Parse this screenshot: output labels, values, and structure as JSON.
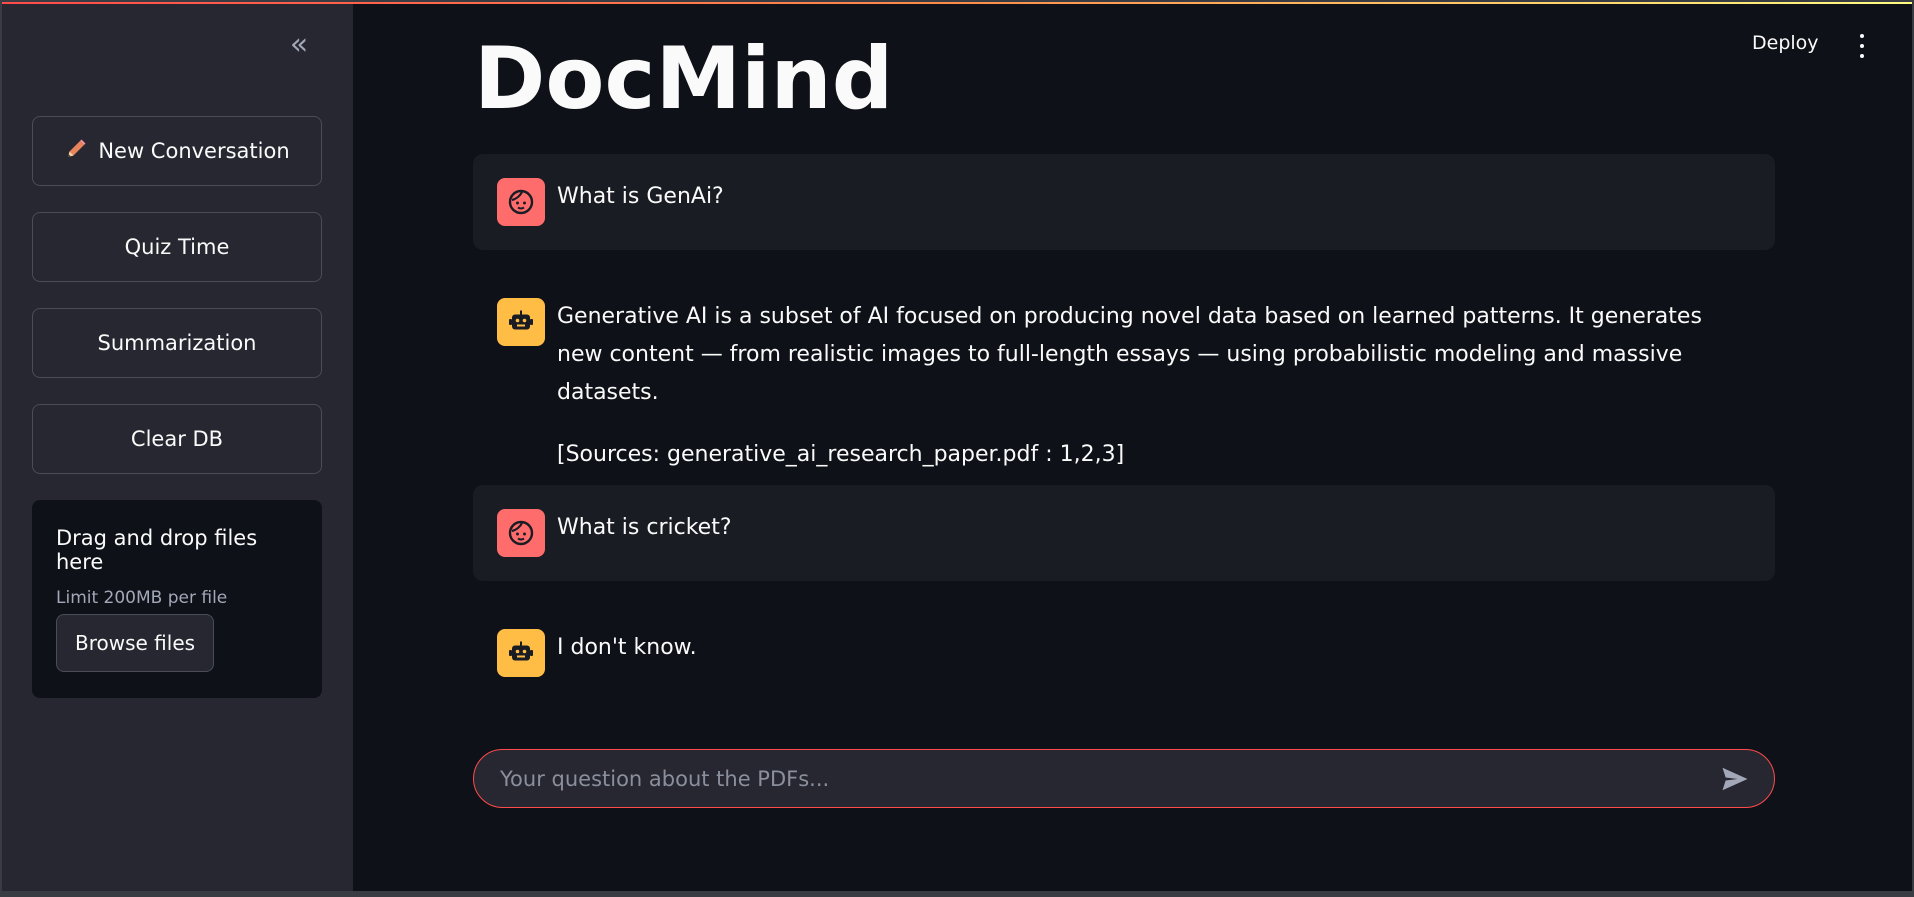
{
  "app": {
    "title": "DocMind",
    "deploy_label": "Deploy"
  },
  "sidebar": {
    "collapse_glyph": "«",
    "buttons": [
      {
        "icon": "pencil-icon",
        "emoji": "✏️",
        "label": "New Conversation"
      },
      {
        "label": "Quiz Time"
      },
      {
        "label": "Summarization"
      },
      {
        "label": "Clear DB"
      }
    ],
    "uploader": {
      "title": "Drag and drop files here",
      "limit": "Limit 200MB per file",
      "browse_label": "Browse files"
    }
  },
  "chat": {
    "messages": [
      {
        "role": "user",
        "avatar_icon": "user-face-icon",
        "paragraphs": [
          "What is GenAi?"
        ]
      },
      {
        "role": "assistant",
        "avatar_icon": "robot-icon",
        "paragraphs": [
          "Generative AI is a subset of AI focused on producing novel data based on learned patterns. It generates new content — from realistic images to full-length essays — using probabilistic modeling and massive datasets.",
          "[Sources: generative_ai_research_paper.pdf : 1,2,3]"
        ]
      },
      {
        "role": "user",
        "avatar_icon": "user-face-icon",
        "paragraphs": [
          "What is cricket?"
        ]
      },
      {
        "role": "assistant",
        "avatar_icon": "robot-icon",
        "paragraphs": [
          "I don't know."
        ]
      }
    ],
    "input": {
      "placeholder": "Your question about the PDFs...",
      "value": ""
    }
  },
  "colors": {
    "background": "#0e1117",
    "sidebar": "#262730",
    "user_avatar": "#ff6c6c",
    "bot_avatar": "#ffbd45",
    "accent": "#ff4b4b"
  }
}
